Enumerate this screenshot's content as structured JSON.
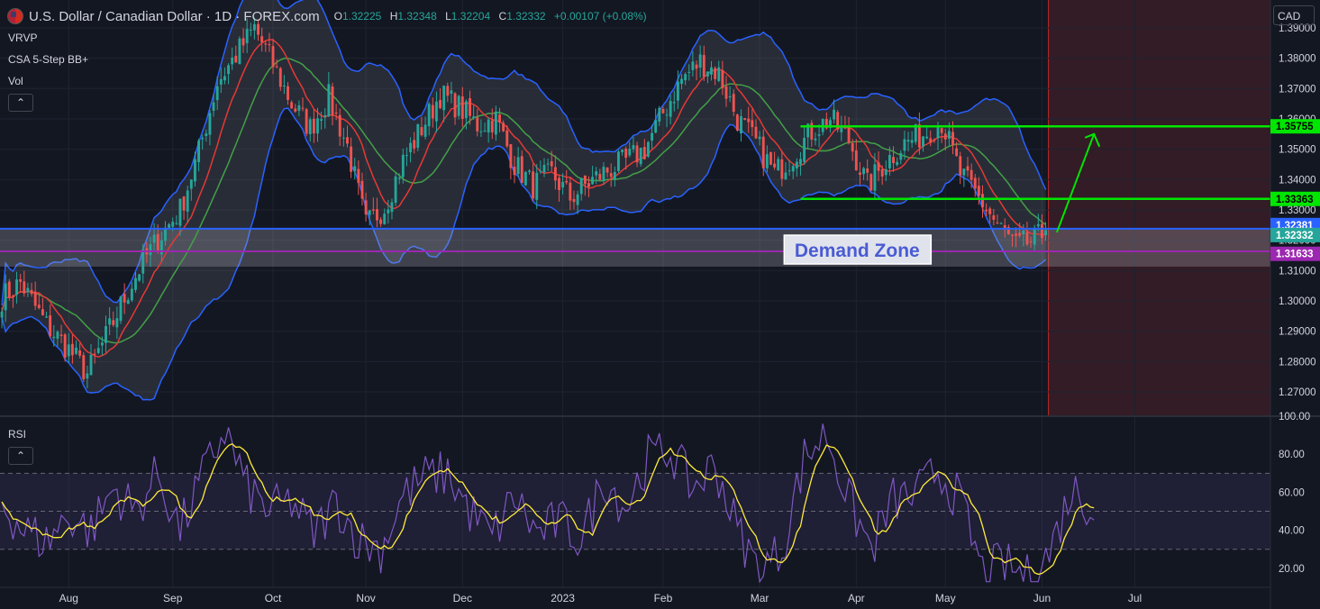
{
  "header": {
    "symbol": "U.S. Dollar / Canadian Dollar · 1D · FOREX.com",
    "open_label": "O",
    "open": "1.32225",
    "high_label": "H",
    "high": "1.32348",
    "low_label": "L",
    "low": "1.32204",
    "close_label": "C",
    "close": "1.32332",
    "change": "+0.00107 (+0.08%)",
    "flag_icon": "usd-cad-flag-icon"
  },
  "indicators": [
    "VRVP",
    "CSA 5-Step BB+",
    "Vol"
  ],
  "rsi_label": "RSI",
  "currency": "CAD",
  "collapse_icon": "chevron-up-icon",
  "colors": {
    "background": "#131722",
    "bull": "#26a69a",
    "bear": "#ef5350",
    "band": "#2962ff",
    "mid_fast": "#e53935",
    "mid_slow": "#43a047",
    "level": "#00e600",
    "support": "#2962ff",
    "demand_line": "#9c27b0",
    "rsi": "#7e57c2",
    "rsi_ma": "#ffeb3b",
    "future_zone": "#3a1d27"
  },
  "chart_data": [
    {
      "type": "candlestick",
      "ylim": [
        1.262,
        1.398
      ],
      "y_ticks": [
        "1.39000",
        "1.38000",
        "1.37000",
        "1.36000",
        "1.35000",
        "1.34000",
        "1.33000",
        "1.32000",
        "1.31000",
        "1.30000",
        "1.29000",
        "1.28000",
        "1.27000"
      ],
      "x_labels": [
        "Aug",
        "Sep",
        "Oct",
        "Nov",
        "Dec",
        "2023",
        "Feb",
        "Mar",
        "Apr",
        "May",
        "Jun",
        "Jul"
      ],
      "series_anchor": [
        [
          0,
          1.301
        ],
        [
          5,
          1.306
        ],
        [
          12,
          1.292
        ],
        [
          18,
          1.284
        ],
        [
          23,
          1.276
        ],
        [
          28,
          1.288
        ],
        [
          33,
          1.301
        ],
        [
          38,
          1.313
        ],
        [
          43,
          1.322
        ],
        [
          48,
          1.33
        ],
        [
          53,
          1.349
        ],
        [
          58,
          1.372
        ],
        [
          63,
          1.381
        ],
        [
          68,
          1.39
        ],
        [
          73,
          1.378
        ],
        [
          78,
          1.365
        ],
        [
          83,
          1.357
        ],
        [
          88,
          1.367
        ],
        [
          93,
          1.351
        ],
        [
          98,
          1.325
        ],
        [
          103,
          1.331
        ],
        [
          108,
          1.346
        ],
        [
          113,
          1.357
        ],
        [
          118,
          1.368
        ],
        [
          123,
          1.364
        ],
        [
          128,
          1.358
        ],
        [
          133,
          1.36
        ],
        [
          138,
          1.345
        ],
        [
          143,
          1.338
        ],
        [
          148,
          1.342
        ],
        [
          153,
          1.334
        ],
        [
          158,
          1.339
        ],
        [
          163,
          1.343
        ],
        [
          168,
          1.346
        ],
        [
          173,
          1.35
        ],
        [
          178,
          1.362
        ],
        [
          183,
          1.373
        ],
        [
          188,
          1.379
        ],
        [
          193,
          1.375
        ],
        [
          198,
          1.36
        ],
        [
          203,
          1.352
        ],
        [
          208,
          1.342
        ],
        [
          213,
          1.348
        ],
        [
          218,
          1.356
        ],
        [
          223,
          1.36
        ],
        [
          228,
          1.353
        ],
        [
          233,
          1.338
        ],
        [
          238,
          1.346
        ],
        [
          243,
          1.352
        ],
        [
          248,
          1.355
        ],
        [
          253,
          1.359
        ],
        [
          258,
          1.342
        ],
        [
          263,
          1.334
        ],
        [
          268,
          1.325
        ],
        [
          273,
          1.318
        ],
        [
          278,
          1.32
        ],
        [
          281,
          1.323
        ]
      ],
      "last_bar_index": 281,
      "future_bars": 60,
      "levels": [
        {
          "name": "resistance",
          "value": 1.35755,
          "label": "1.35755",
          "from_bar": 215
        },
        {
          "name": "support",
          "value": 1.33363,
          "label": "1.33363",
          "from_bar": 215
        }
      ],
      "support_line": {
        "value": 1.32381,
        "label": "1.32381"
      },
      "current_price": {
        "value": 1.32332,
        "label": "1.32332"
      },
      "demand_zone": {
        "top": 1.324,
        "bottom": 1.3113,
        "line": 1.31633,
        "line_label": "1.31633",
        "label": "Demand Zone",
        "label_bar": 230
      },
      "arrow": {
        "from_bar": 284,
        "from": 1.3226,
        "to_bar": 294,
        "to": 1.355
      }
    },
    {
      "type": "line",
      "name": "RSI",
      "ylim": [
        10,
        100
      ],
      "y_ticks": [
        "100.00",
        "80.00",
        "60.00",
        "40.00",
        "20.00"
      ],
      "band": [
        30,
        70
      ],
      "mid": 50,
      "rsi_anchor": [
        [
          0,
          55
        ],
        [
          6,
          40
        ],
        [
          12,
          34
        ],
        [
          18,
          48
        ],
        [
          24,
          40
        ],
        [
          30,
          62
        ],
        [
          36,
          50
        ],
        [
          42,
          70
        ],
        [
          48,
          40
        ],
        [
          54,
          68
        ],
        [
          60,
          93
        ],
        [
          66,
          62
        ],
        [
          72,
          50
        ],
        [
          78,
          55
        ],
        [
          84,
          38
        ],
        [
          90,
          55
        ],
        [
          96,
          35
        ],
        [
          102,
          30
        ],
        [
          108,
          58
        ],
        [
          114,
          68
        ],
        [
          120,
          70
        ],
        [
          126,
          50
        ],
        [
          132,
          36
        ],
        [
          138,
          58
        ],
        [
          144,
          38
        ],
        [
          150,
          45
        ],
        [
          156,
          35
        ],
        [
          162,
          68
        ],
        [
          168,
          52
        ],
        [
          174,
          78
        ],
        [
          180,
          82
        ],
        [
          186,
          62
        ],
        [
          192,
          75
        ],
        [
          198,
          40
        ],
        [
          204,
          18
        ],
        [
          210,
          30
        ],
        [
          216,
          78
        ],
        [
          222,
          92
        ],
        [
          228,
          55
        ],
        [
          234,
          30
        ],
        [
          240,
          56
        ],
        [
          246,
          58
        ],
        [
          252,
          72
        ],
        [
          258,
          55
        ],
        [
          264,
          18
        ],
        [
          270,
          22
        ],
        [
          276,
          15
        ],
        [
          282,
          28
        ],
        [
          288,
          62
        ],
        [
          294,
          52
        ]
      ]
    }
  ]
}
